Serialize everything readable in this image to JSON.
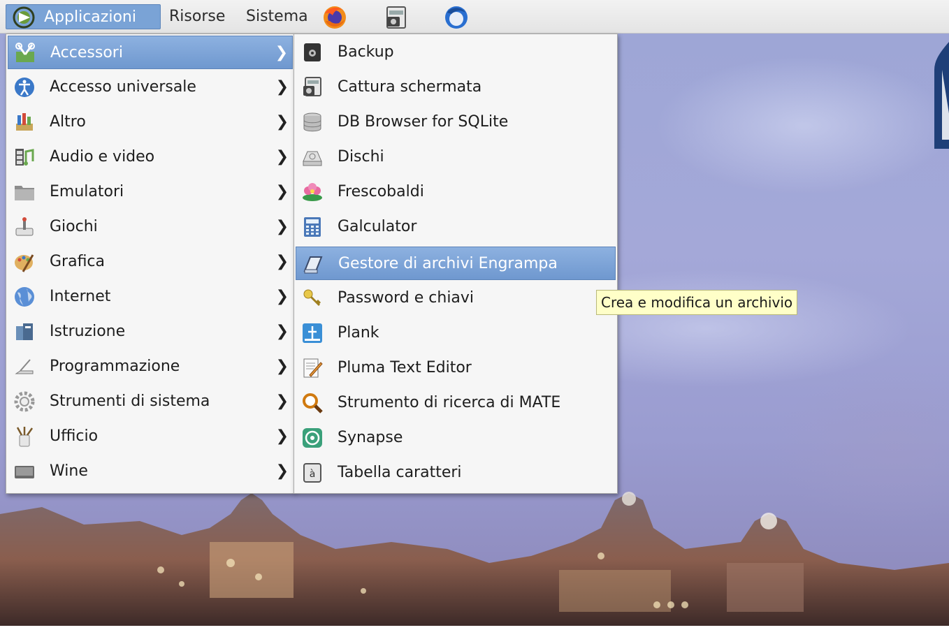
{
  "panel": {
    "menus": [
      {
        "label": "Applicazioni"
      },
      {
        "label": "Risorse"
      },
      {
        "label": "Sistema"
      }
    ],
    "launchers": [
      "firefox-icon",
      "screenshot-icon",
      "thunderbird-icon"
    ]
  },
  "categories": [
    {
      "label": "Accessori",
      "icon": "accessories-icon",
      "selected": true
    },
    {
      "label": "Accesso universale",
      "icon": "accessibility-icon"
    },
    {
      "label": "Altro",
      "icon": "other-icon"
    },
    {
      "label": "Audio e video",
      "icon": "multimedia-icon"
    },
    {
      "label": "Emulatori",
      "icon": "folder-icon"
    },
    {
      "label": "Giochi",
      "icon": "games-icon"
    },
    {
      "label": "Grafica",
      "icon": "graphics-icon"
    },
    {
      "label": "Internet",
      "icon": "internet-icon"
    },
    {
      "label": "Istruzione",
      "icon": "education-icon"
    },
    {
      "label": "Programmazione",
      "icon": "development-icon"
    },
    {
      "label": "Strumenti di sistema",
      "icon": "system-tools-icon"
    },
    {
      "label": "Ufficio",
      "icon": "office-icon"
    },
    {
      "label": "Wine",
      "icon": "wine-icon"
    }
  ],
  "accessori": [
    {
      "label": "Backup",
      "icon": "backup-icon"
    },
    {
      "label": "Cattura schermata",
      "icon": "screenshot-icon"
    },
    {
      "label": "DB Browser for SQLite",
      "icon": "database-icon"
    },
    {
      "label": "Dischi",
      "icon": "disks-icon"
    },
    {
      "label": "Frescobaldi",
      "icon": "frescobaldi-icon"
    },
    {
      "label": "Galculator",
      "icon": "calculator-icon"
    },
    {
      "label": "Gestore di archivi Engrampa",
      "icon": "archive-manager-icon",
      "selected": true
    },
    {
      "label": "Password e chiavi",
      "icon": "keys-icon"
    },
    {
      "label": "Plank",
      "icon": "plank-icon"
    },
    {
      "label": "Pluma Text Editor",
      "icon": "text-editor-icon"
    },
    {
      "label": "Strumento di ricerca di MATE",
      "icon": "search-tool-icon"
    },
    {
      "label": "Synapse",
      "icon": "synapse-icon"
    },
    {
      "label": "Tabella caratteri",
      "icon": "character-map-icon"
    }
  ],
  "tooltip": "Crea e modifica un archivio",
  "colors": {
    "selection": "#7aa3d6",
    "tooltip_bg": "#ffffc8",
    "menu_bg": "#f6f6f6"
  }
}
